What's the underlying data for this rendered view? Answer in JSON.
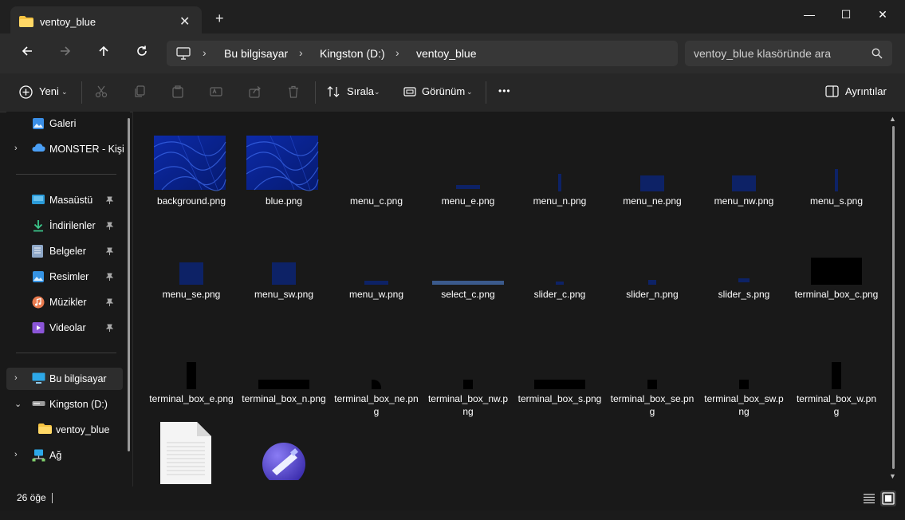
{
  "window": {
    "tab_title": "ventoy_blue",
    "close_tab": "✕",
    "new_tab": "+",
    "minimize": "—",
    "maximize": "☐",
    "close": "✕"
  },
  "address": {
    "crumbs": [
      "Bu bilgisayar",
      "Kingston (D:)",
      "ventoy_blue"
    ],
    "separator": "›"
  },
  "search": {
    "placeholder": "ventoy_blue klasöründe ara"
  },
  "commands": {
    "new": "Yeni",
    "sort": "Sırala",
    "view": "Görünüm",
    "more": "•••",
    "details": "Ayrıntılar"
  },
  "sidebar": {
    "items": [
      {
        "label": "Galeri",
        "icon": "gallery-icon"
      },
      {
        "label": "MONSTER - Kişi",
        "icon": "onedrive-icon"
      },
      {
        "label": "Masaüstü",
        "icon": "desktop-icon"
      },
      {
        "label": "İndirilenler",
        "icon": "downloads-icon"
      },
      {
        "label": "Belgeler",
        "icon": "documents-icon"
      },
      {
        "label": "Resimler",
        "icon": "pictures-icon"
      },
      {
        "label": "Müzikler",
        "icon": "music-icon"
      },
      {
        "label": "Videolar",
        "icon": "videos-icon"
      },
      {
        "label": "Bu bilgisayar",
        "icon": "computer-icon"
      },
      {
        "label": "Kingston (D:)",
        "icon": "drive-icon"
      },
      {
        "label": "ventoy_blue",
        "icon": "folder-icon"
      },
      {
        "label": "Ağ",
        "icon": "network-icon"
      }
    ]
  },
  "files": [
    {
      "name": "background.png"
    },
    {
      "name": "blue.png"
    },
    {
      "name": "menu_c.png"
    },
    {
      "name": "menu_e.png"
    },
    {
      "name": "menu_n.png"
    },
    {
      "name": "menu_ne.png"
    },
    {
      "name": "menu_nw.png"
    },
    {
      "name": "menu_s.png"
    },
    {
      "name": "menu_se.png"
    },
    {
      "name": "menu_sw.png"
    },
    {
      "name": "menu_w.png"
    },
    {
      "name": "select_c.png"
    },
    {
      "name": "slider_c.png"
    },
    {
      "name": "slider_n.png"
    },
    {
      "name": "slider_s.png"
    },
    {
      "name": "terminal_box_c.png"
    },
    {
      "name": "terminal_box_e.png"
    },
    {
      "name": "terminal_box_n.png"
    },
    {
      "name": "terminal_box_ne.png"
    },
    {
      "name": "terminal_box_nw.png"
    },
    {
      "name": "terminal_box_s.png"
    },
    {
      "name": "terminal_box_se.png"
    },
    {
      "name": "terminal_box_sw.png"
    },
    {
      "name": "terminal_box_w.png"
    },
    {
      "name": ""
    },
    {
      "name": ""
    }
  ],
  "status": {
    "count": "26 öğe"
  },
  "colors": {
    "navy": "#0d2266",
    "folder": "#f5c342",
    "accent": "#4cc2ff"
  }
}
